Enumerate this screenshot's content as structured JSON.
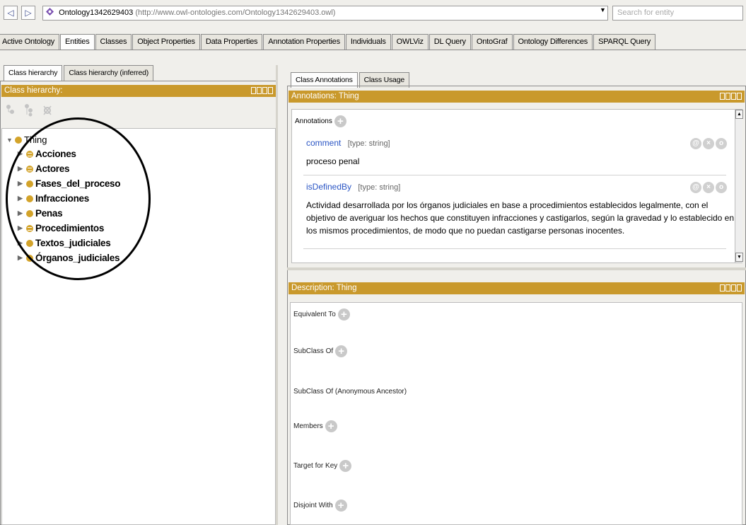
{
  "address_bar": {
    "back_glyph": "◁",
    "forward_glyph": "▷",
    "ontology_name": "Ontology1342629403",
    "ontology_iri": "(http://www.owl-ontologies.com/Ontology1342629403.owl)",
    "dropdown_glyph": "▼",
    "search_placeholder": "Search for entity"
  },
  "main_tabs": [
    {
      "label": "Active Ontology",
      "active": false
    },
    {
      "label": "Entities",
      "active": true
    },
    {
      "label": "Classes",
      "active": false
    },
    {
      "label": "Object Properties",
      "active": false
    },
    {
      "label": "Data Properties",
      "active": false
    },
    {
      "label": "Annotation Properties",
      "active": false
    },
    {
      "label": "Individuals",
      "active": false
    },
    {
      "label": "OWLViz",
      "active": false
    },
    {
      "label": "DL Query",
      "active": false
    },
    {
      "label": "OntoGraf",
      "active": false
    },
    {
      "label": "Ontology Differences",
      "active": false
    },
    {
      "label": "SPARQL Query",
      "active": false
    }
  ],
  "left_panel": {
    "tabs": [
      {
        "label": "Class hierarchy",
        "active": true
      },
      {
        "label": "Class hierarchy (inferred)",
        "active": false
      }
    ],
    "title": "Class hierarchy:",
    "root": "Thing",
    "classes": [
      {
        "label": "Acciones",
        "equivalent": true
      },
      {
        "label": "Actores",
        "equivalent": true
      },
      {
        "label": "Fases_del_proceso",
        "equivalent": false
      },
      {
        "label": "Infracciones",
        "equivalent": false
      },
      {
        "label": "Penas",
        "equivalent": false
      },
      {
        "label": "Procedimientos",
        "equivalent": true
      },
      {
        "label": "Textos_judiciales",
        "equivalent": false
      },
      {
        "label": "Órganos_judiciales",
        "equivalent": false
      }
    ]
  },
  "right_panel": {
    "tabs": [
      {
        "label": "Class Annotations",
        "active": true
      },
      {
        "label": "Class Usage",
        "active": false
      }
    ],
    "annotations_title": "Annotations: Thing",
    "annotations_label": "Annotations",
    "annotations": [
      {
        "property": "comment",
        "type": "[type: string]",
        "value": "proceso penal"
      },
      {
        "property": "isDefinedBy",
        "type": "[type: string]",
        "value": "Actividad desarrollada por los órganos judiciales en base a procedimientos establecidos legalmente, con el objetivo de averiguar los hechos que constituyen infracciones y castigarlos, según la gravedad y lo establecido en los mismos procedimientos, de modo que no puedan castigarse personas inocentes."
      }
    ],
    "description_title": "Description: Thing",
    "description_sections": [
      {
        "label": "Equivalent To",
        "has_add": true
      },
      {
        "label": "SubClass Of",
        "has_add": true
      },
      {
        "label": "SubClass Of (Anonymous Ancestor)",
        "has_add": false
      },
      {
        "label": "Members",
        "has_add": true
      },
      {
        "label": "Target for Key",
        "has_add": true
      },
      {
        "label": "Disjoint With",
        "has_add": true
      }
    ]
  },
  "colors": {
    "header_gold": "#c9992c",
    "class_dot": "#d3a32a",
    "link_blue": "#2a55c4",
    "background": "#f0efeb"
  }
}
